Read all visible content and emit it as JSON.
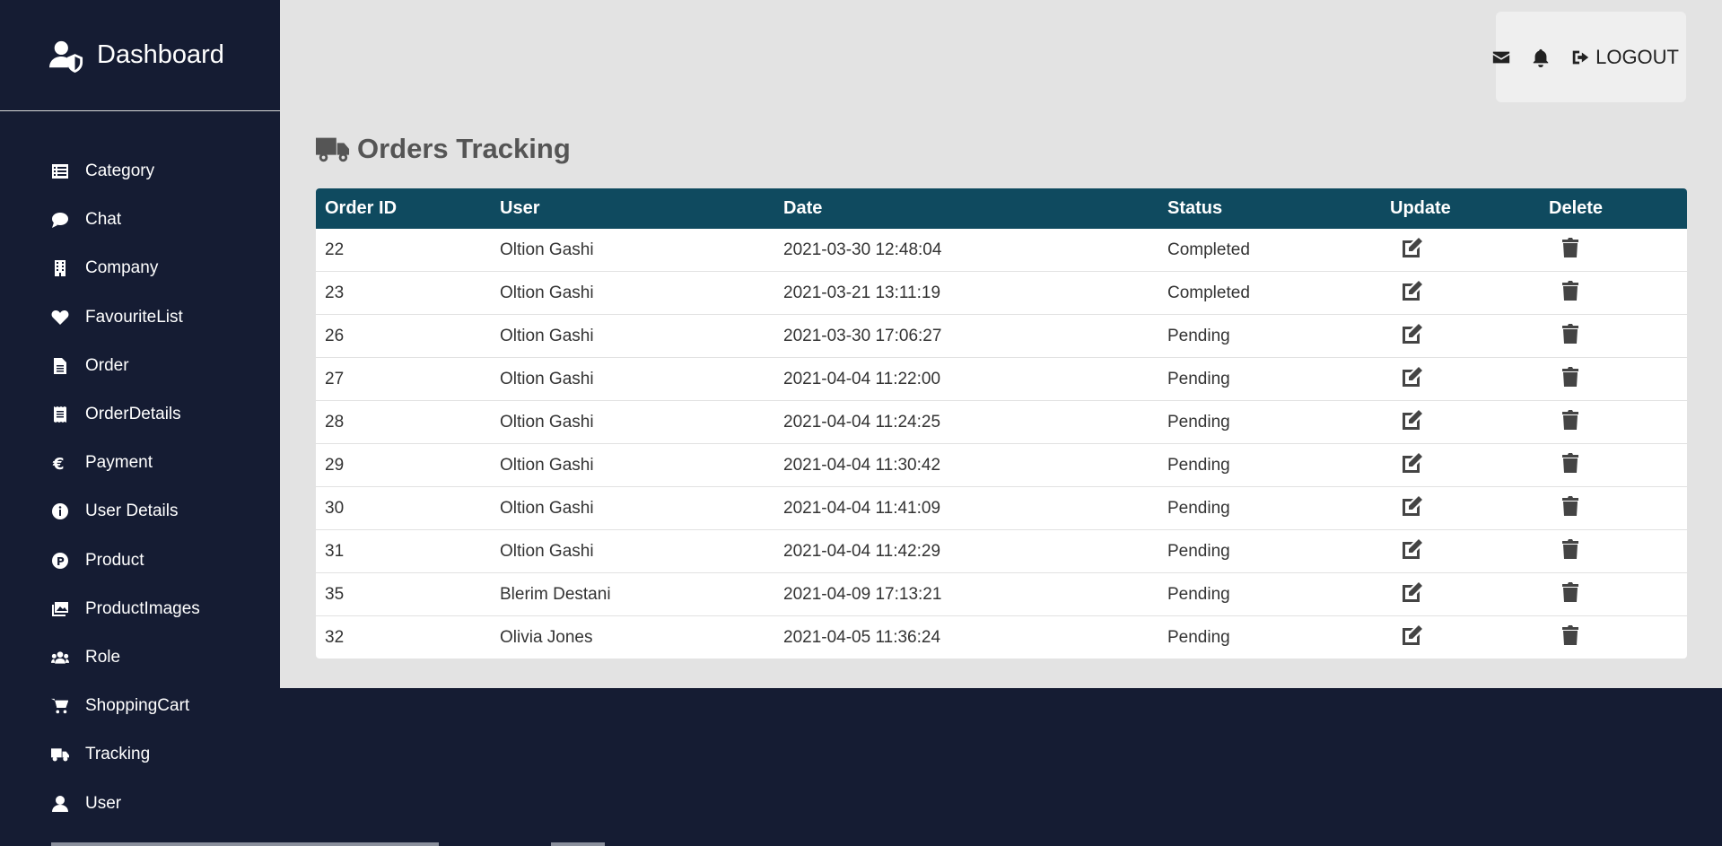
{
  "sidebar": {
    "brand": "Dashboard",
    "items": [
      {
        "label": "Category",
        "icon": "list-icon"
      },
      {
        "label": "Chat",
        "icon": "chat-icon"
      },
      {
        "label": "Company",
        "icon": "building-icon"
      },
      {
        "label": "FavouriteList",
        "icon": "heart-icon"
      },
      {
        "label": "Order",
        "icon": "file-icon"
      },
      {
        "label": "OrderDetails",
        "icon": "receipt-icon"
      },
      {
        "label": "Payment",
        "icon": "euro-icon"
      },
      {
        "label": "User Details",
        "icon": "info-icon"
      },
      {
        "label": "Product",
        "icon": "product-icon"
      },
      {
        "label": "ProductImages",
        "icon": "images-icon"
      },
      {
        "label": "Role",
        "icon": "users-icon"
      },
      {
        "label": "ShoppingCart",
        "icon": "cart-icon"
      },
      {
        "label": "Tracking",
        "icon": "truck-icon"
      },
      {
        "label": "User",
        "icon": "user-icon"
      }
    ]
  },
  "topbar": {
    "logout_label": "LOGOUT"
  },
  "page": {
    "title": "Orders Tracking"
  },
  "table": {
    "headers": [
      "Order ID",
      "User",
      "Date",
      "Status",
      "Update",
      "Delete"
    ],
    "rows": [
      {
        "id": "22",
        "user": "Oltion Gashi",
        "date": "2021-03-30 12:48:04",
        "status": "Completed"
      },
      {
        "id": "23",
        "user": "Oltion Gashi",
        "date": "2021-03-21 13:11:19",
        "status": "Completed"
      },
      {
        "id": "26",
        "user": "Oltion Gashi",
        "date": "2021-03-30 17:06:27",
        "status": "Pending"
      },
      {
        "id": "27",
        "user": "Oltion Gashi",
        "date": "2021-04-04 11:22:00",
        "status": "Pending"
      },
      {
        "id": "28",
        "user": "Oltion Gashi",
        "date": "2021-04-04 11:24:25",
        "status": "Pending"
      },
      {
        "id": "29",
        "user": "Oltion Gashi",
        "date": "2021-04-04 11:30:42",
        "status": "Pending"
      },
      {
        "id": "30",
        "user": "Oltion Gashi",
        "date": "2021-04-04 11:41:09",
        "status": "Pending"
      },
      {
        "id": "31",
        "user": "Oltion Gashi",
        "date": "2021-04-04 11:42:29",
        "status": "Pending"
      },
      {
        "id": "35",
        "user": "Blerim Destani",
        "date": "2021-04-09 17:13:21",
        "status": "Pending"
      },
      {
        "id": "32",
        "user": "Olivia Jones",
        "date": "2021-04-05 11:36:24",
        "status": "Pending"
      }
    ]
  },
  "colors": {
    "sidebar_bg": "#151c33",
    "main_bg": "#e3e3e3",
    "table_header_bg": "#0f4a5f"
  }
}
